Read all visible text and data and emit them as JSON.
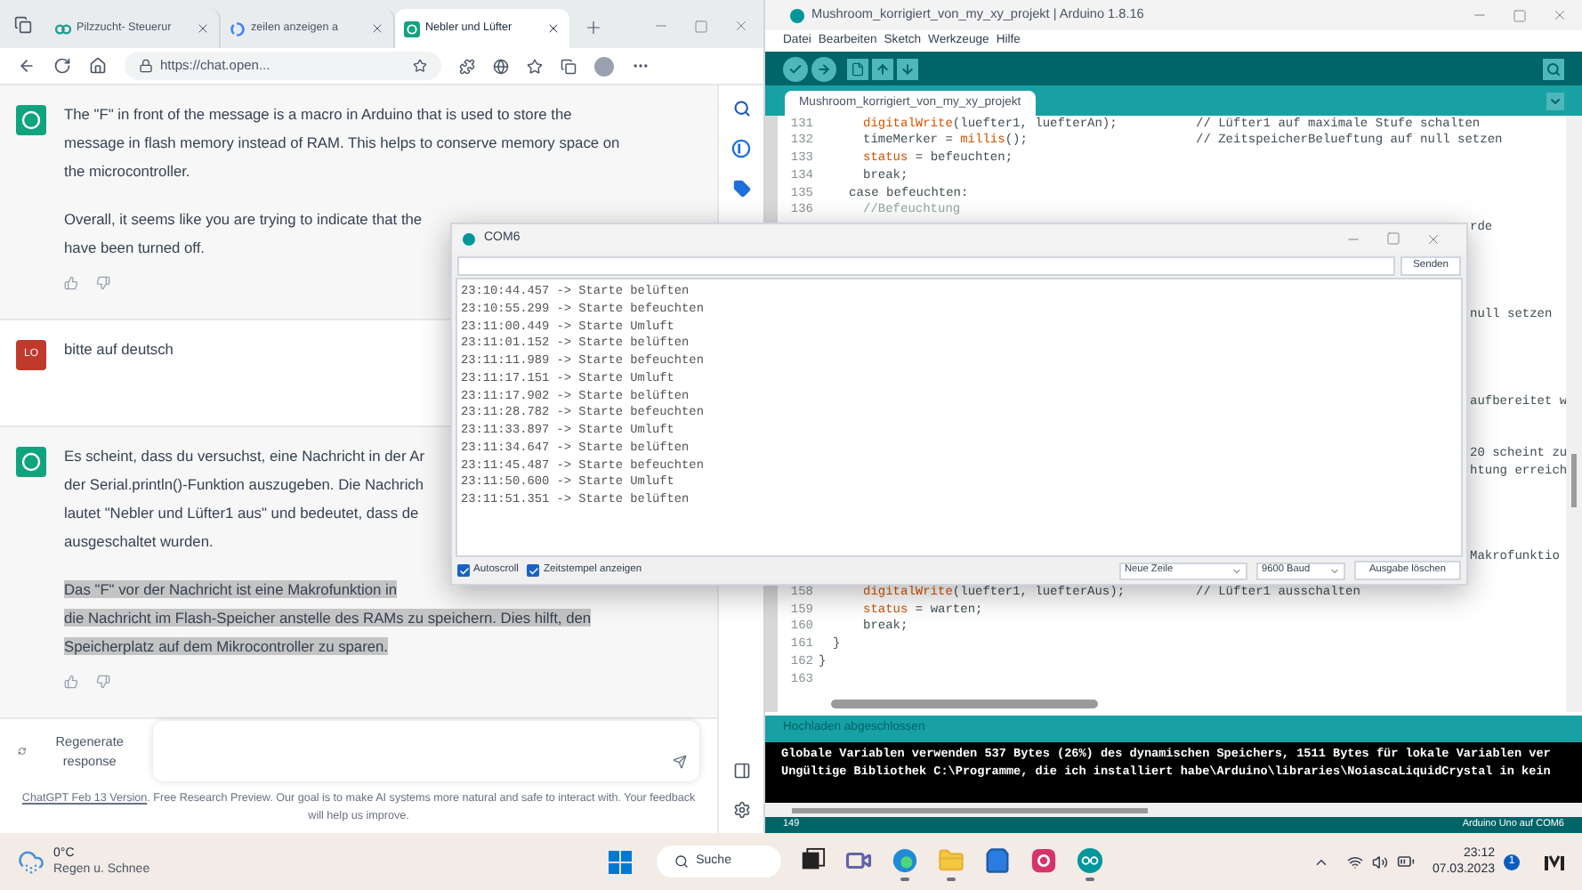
{
  "browser": {
    "tabs": [
      {
        "title": "Pilzzucht- Steuerur",
        "kind": "pilz",
        "selected": false
      },
      {
        "title": "zeilen anzeigen a",
        "kind": "google",
        "selected": false
      },
      {
        "title": "Nebler und Lüfter",
        "kind": "chat",
        "selected": true
      }
    ],
    "address": "https://chat.open...",
    "messages": [
      {
        "kind": "assistant",
        "paragraphs": [
          {
            "lines": [
              "The \"F\" in front of the message is a macro in Arduino that is used to store the",
              "message in flash memory instead of RAM. This helps to conserve memory space on",
              "the microcontroller."
            ],
            "highlighted": false
          },
          {
            "lines": [
              "Overall, it seems like you are trying to indicate that the",
              "have been turned off."
            ],
            "highlighted": false
          }
        ]
      },
      {
        "kind": "user",
        "avatar": "LO",
        "paragraphs": [
          {
            "lines": [
              "bitte auf deutsch"
            ],
            "highlighted": false
          }
        ]
      },
      {
        "kind": "assistant",
        "paragraphs": [
          {
            "lines": [
              "Es scheint, dass du versuchst, eine Nachricht in der Ar",
              "der Serial.println()-Funktion auszugeben. Die Nachrich",
              "lautet \"Nebler und Lüfter1 aus\" und bedeutet, dass de",
              "ausgeschaltet wurden."
            ],
            "highlighted": false
          },
          {
            "lines": [
              "Das \"F\" vor der Nachricht ist eine Makrofunktion in",
              "die Nachricht im Flash-Speicher anstelle des RAMs zu speichern. Dies hilft, den",
              "Speicherplatz auf dem Mikrocontroller zu sparen."
            ],
            "highlighted": true
          }
        ]
      }
    ],
    "regenerate_button": "Regenerate response",
    "footer_link": "ChatGPT Feb 13 Version",
    "footer_text": ". Free Research Preview. Our goal is to make AI systems more natural and safe to interact with. Your feedback will help us improve."
  },
  "arduino": {
    "title": "Mushroom_korrigiert_von_my_xy_projekt | Arduino 1.8.16",
    "menu": [
      "Datei",
      "Bearbeiten",
      "Sketch",
      "Werkzeuge",
      "Hilfe"
    ],
    "tab": "Mushroom_korrigiert_von_my_xy_projekt",
    "code_lines": [
      {
        "kind": "body",
        "number": "131",
        "parts": [
          {
            "kind": "highlight",
            "text": "digitalWrite"
          },
          {
            "kind": "plain",
            "text": "(luefter1, luefterAn);"
          }
        ],
        "comment": "// Lüfter1 auf maximale Stufe schalten"
      },
      {
        "kind": "body",
        "number": "132",
        "parts": [
          {
            "kind": "plain",
            "text": "timeMerker = "
          },
          {
            "kind": "highlight",
            "text": "millis"
          },
          {
            "kind": "plain",
            "text": "();"
          }
        ],
        "comment": "// ZeitspeicherBelueftung auf null setzen"
      },
      {
        "kind": "body",
        "number": "133",
        "parts": [
          {
            "kind": "highlight",
            "text": "status"
          },
          {
            "kind": "plain",
            "text": " = befeuchten;"
          }
        ]
      },
      {
        "kind": "body",
        "number": "134",
        "parts": [
          {
            "kind": "plain",
            "text": "break;"
          }
        ]
      },
      {
        "kind": "case",
        "number": "135",
        "parts": [
          {
            "kind": "plain",
            "text": "case befeuchten:"
          }
        ]
      },
      {
        "kind": "body",
        "number": "136",
        "parts": [
          {
            "kind": "comment",
            "text": "//Befeuchtung"
          }
        ]
      },
      {
        "kind": "hidden",
        "tail": "rde"
      },
      {
        "kind": "hidden"
      },
      {
        "kind": "hidden"
      },
      {
        "kind": "hidden"
      },
      {
        "kind": "hidden"
      },
      {
        "kind": "hidden",
        "tail": "null setzen"
      },
      {
        "kind": "hidden"
      },
      {
        "kind": "hidden"
      },
      {
        "kind": "hidden"
      },
      {
        "kind": "hidden"
      },
      {
        "kind": "hidden",
        "tail": "aufbereitet w"
      },
      {
        "kind": "hidden"
      },
      {
        "kind": "hidden"
      },
      {
        "kind": "hidden",
        "tail": "20 scheint zu"
      },
      {
        "kind": "hidden",
        "tail": "htung erreich"
      },
      {
        "kind": "hidden"
      },
      {
        "kind": "hidden"
      },
      {
        "kind": "hidden"
      },
      {
        "kind": "hidden"
      },
      {
        "kind": "hidden",
        "tail": "Makrofunktio"
      },
      {
        "kind": "hidden"
      },
      {
        "kind": "body",
        "number": "158",
        "parts": [
          {
            "kind": "highlight",
            "text": "digitalWrite"
          },
          {
            "kind": "plain",
            "text": "(luefter1, luefterAus);"
          }
        ],
        "comment": "// Lüfter1 ausschalten"
      },
      {
        "kind": "body",
        "number": "159",
        "parts": [
          {
            "kind": "highlight",
            "text": "status"
          },
          {
            "kind": "plain",
            "text": " = warten;"
          }
        ]
      },
      {
        "kind": "body",
        "number": "160",
        "parts": [
          {
            "kind": "plain",
            "text": "break;"
          }
        ]
      },
      {
        "kind": "switch",
        "number": "161",
        "parts": [
          {
            "kind": "plain",
            "text": "}"
          }
        ]
      },
      {
        "kind": "top",
        "number": "162",
        "parts": [
          {
            "kind": "plain",
            "text": "}"
          }
        ]
      },
      {
        "kind": "top",
        "number": "163"
      }
    ],
    "status": "Hochladen abgeschlossen",
    "console": [
      "Globale Variablen verwenden 537 Bytes (26%) des dynamischen Speichers, 1511 Bytes für lokale Variablen ver",
      "Ungültige Bibliothek C:\\Programme, die ich installiert habe\\Arduino\\libraries\\NoiascaLiquidCrystal in kein"
    ],
    "line_indicator": "149",
    "board": "Arduino Uno auf COM6"
  },
  "serial": {
    "title": "COM6",
    "send_button": "Senden",
    "log": [
      "23:10:44.457 -> Starte belüften",
      "23:10:55.299 -> Starte befeuchten",
      "23:11:00.449 -> Starte Umluft",
      "23:11:01.152 -> Starte belüften",
      "23:11:11.989 -> Starte befeuchten",
      "23:11:17.151 -> Starte Umluft",
      "23:11:17.902 -> Starte belüften",
      "23:11:28.782 -> Starte befeuchten",
      "23:11:33.897 -> Starte Umluft",
      "23:11:34.647 -> Starte belüften",
      "23:11:45.487 -> Starte befeuchten",
      "23:11:50.600 -> Starte Umluft",
      "23:11:51.351 -> Starte belüften"
    ],
    "options": [
      {
        "label": "Autoscroll",
        "checked": true
      },
      {
        "label": "Zeitstempel anzeigen",
        "checked": true
      }
    ],
    "line_ending": "Neue Zeile",
    "baud": "9600 Baud",
    "clear_button": "Ausgabe löschen"
  },
  "taskbar": {
    "temperature": "0°C",
    "weather": "Regen u. Schnee",
    "search": "Suche",
    "apps": [
      {
        "kind": "taskview",
        "running": false
      },
      {
        "kind": "teams",
        "running": false
      },
      {
        "kind": "edge",
        "running": true
      },
      {
        "kind": "files",
        "running": true
      },
      {
        "kind": "store",
        "running": false
      },
      {
        "kind": "instagram",
        "running": false
      },
      {
        "kind": "arduino",
        "running": true
      }
    ],
    "time": "23:12",
    "date": "07.03.2023",
    "notifications": "1"
  }
}
